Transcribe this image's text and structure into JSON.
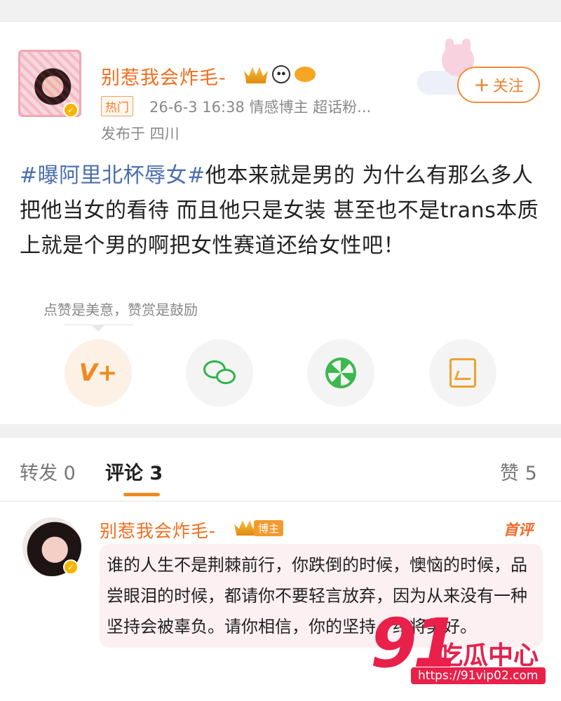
{
  "post": {
    "username": "别惹我会炸毛-",
    "hot_label": "热门",
    "meta": "26-6-3 16:38  情感博主 超话粉...",
    "location": "发布于 四川",
    "follow_label": "关注",
    "hashtag": "#曝阿里北杯辱女#",
    "text": "他本来就是男的 为什么有那么多人把他当女的看待 而且他只是女装 甚至也不是trans本质上就是个男的啊把女性赛道还给女性吧！",
    "reward_tip": "点赞是美意，赞赏是鼓励",
    "share_icons": [
      "v-plus-icon",
      "wechat-icon",
      "moments-icon",
      "album-icon"
    ]
  },
  "tabs": {
    "repost": "转发 0",
    "comments": "评论 3",
    "likes": "赞 5"
  },
  "comment": {
    "username": "别惹我会炸毛-",
    "badge": "博主",
    "first_label": "首评",
    "text": "谁的人生不是荆棘前行，你跌倒的时候，懊恼的时候，品尝眼泪的时候，都请你不要轻言放弃，因为从来没有一种坚持会被辜负。请你相信，你的坚持，终将美好。"
  },
  "watermark": {
    "number": "91",
    "site": "吃瓜中心",
    "url": "https://91vip02.com"
  },
  "colors": {
    "accent": "#f06e1e",
    "hashtag": "#4a6eae",
    "watermark": "#e8204a"
  }
}
